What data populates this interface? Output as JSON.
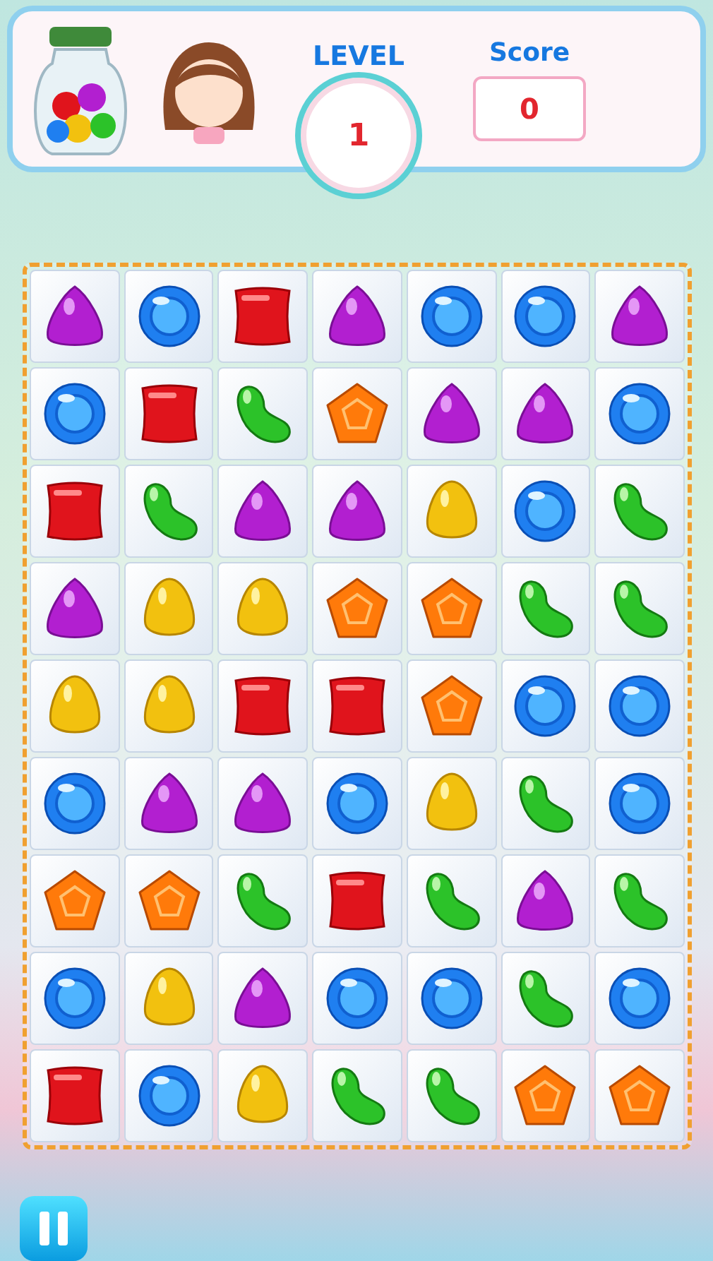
{
  "header": {
    "level_label": "LEVEL",
    "level": "1",
    "score_label": "Score",
    "score": "0"
  },
  "board": {
    "rows": [
      [
        {
          "kind": "drop"
        },
        {
          "kind": "round"
        },
        {
          "kind": "square"
        },
        {
          "kind": "drop"
        },
        {
          "kind": "round"
        },
        {
          "kind": "round"
        },
        {
          "kind": "drop"
        }
      ],
      [
        {
          "kind": "round"
        },
        {
          "kind": "square"
        },
        {
          "kind": "bean"
        },
        {
          "kind": "pentagon"
        },
        {
          "kind": "drop"
        },
        {
          "kind": "drop"
        },
        {
          "kind": "round"
        }
      ],
      [
        {
          "kind": "square"
        },
        {
          "kind": "bean"
        },
        {
          "kind": "drop"
        },
        {
          "kind": "drop"
        },
        {
          "kind": "egg"
        },
        {
          "kind": "round"
        },
        {
          "kind": "bean"
        }
      ],
      [
        {
          "kind": "drop"
        },
        {
          "kind": "egg"
        },
        {
          "kind": "egg"
        },
        {
          "kind": "pentagon"
        },
        {
          "kind": "pentagon"
        },
        {
          "kind": "bean"
        },
        {
          "kind": "bean"
        }
      ],
      [
        {
          "kind": "egg"
        },
        {
          "kind": "egg"
        },
        {
          "kind": "square"
        },
        {
          "kind": "square"
        },
        {
          "kind": "pentagon"
        },
        {
          "kind": "round"
        },
        {
          "kind": "round"
        }
      ],
      [
        {
          "kind": "round"
        },
        {
          "kind": "drop"
        },
        {
          "kind": "drop"
        },
        {
          "kind": "round"
        },
        {
          "kind": "egg"
        },
        {
          "kind": "bean"
        },
        {
          "kind": "round"
        }
      ],
      [
        {
          "kind": "pentagon"
        },
        {
          "kind": "pentagon"
        },
        {
          "kind": "bean"
        },
        {
          "kind": "square"
        },
        {
          "kind": "bean"
        },
        {
          "kind": "drop"
        },
        {
          "kind": "bean"
        }
      ],
      [
        {
          "kind": "round"
        },
        {
          "kind": "egg"
        },
        {
          "kind": "drop"
        },
        {
          "kind": "round"
        },
        {
          "kind": "round"
        },
        {
          "kind": "bean"
        },
        {
          "kind": "round"
        }
      ],
      [
        {
          "kind": "square"
        },
        {
          "kind": "round"
        },
        {
          "kind": "egg"
        },
        {
          "kind": "bean"
        },
        {
          "kind": "bean"
        },
        {
          "kind": "pentagon"
        },
        {
          "kind": "pentagon"
        }
      ]
    ]
  }
}
